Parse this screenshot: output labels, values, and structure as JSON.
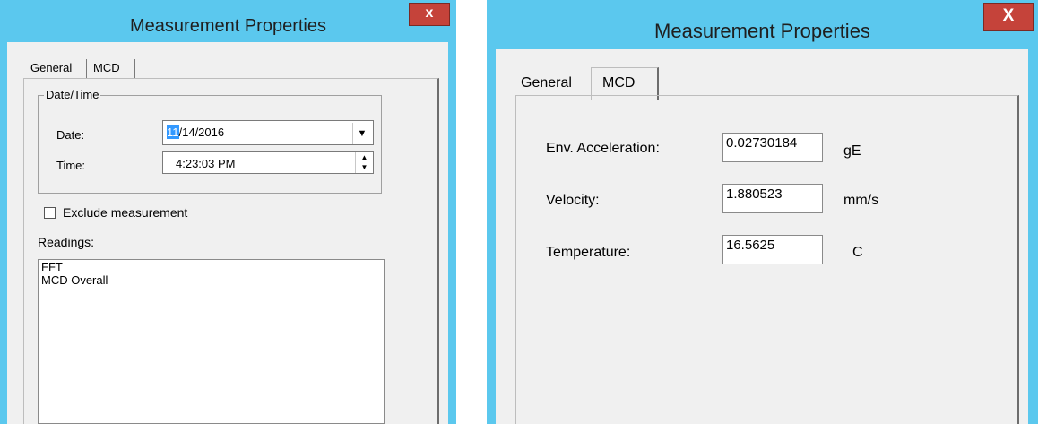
{
  "left_window": {
    "title": "Measurement Properties",
    "close_label": "x",
    "tabs": [
      {
        "label": "General",
        "active": true
      },
      {
        "label": "MCD",
        "active": false
      }
    ],
    "datetime_group": {
      "title": "Date/Time",
      "date_label": "Date:",
      "date_selected": "11",
      "date_rest": "/14/2016",
      "time_label": "Time:",
      "time_value": "4:23:03 PM"
    },
    "exclude_label": "Exclude measurement",
    "exclude_checked": false,
    "readings_label": "Readings:",
    "readings": [
      "FFT",
      "MCD Overall"
    ]
  },
  "right_window": {
    "title": "Measurement Properties",
    "close_label": "X",
    "tabs": [
      {
        "label": "General",
        "active": false
      },
      {
        "label": "MCD",
        "active": true
      }
    ],
    "fields": [
      {
        "label": "Env. Acceleration:",
        "value": "0.02730184",
        "unit": "gE"
      },
      {
        "label": "Velocity:",
        "value": "1.880523",
        "unit": "mm/s"
      },
      {
        "label": "Temperature:",
        "value": "16.5625",
        "unit": "C"
      }
    ]
  },
  "colors": {
    "title_bar": "#5bc8ee",
    "close_button": "#c5433a",
    "selection": "#3399ff",
    "client_bg": "#f0f0f0"
  },
  "icons": {
    "dropdown": "chevron-down-icon",
    "spin_up": "spin-up-icon",
    "spin_down": "spin-down-icon",
    "close": "close-icon"
  }
}
